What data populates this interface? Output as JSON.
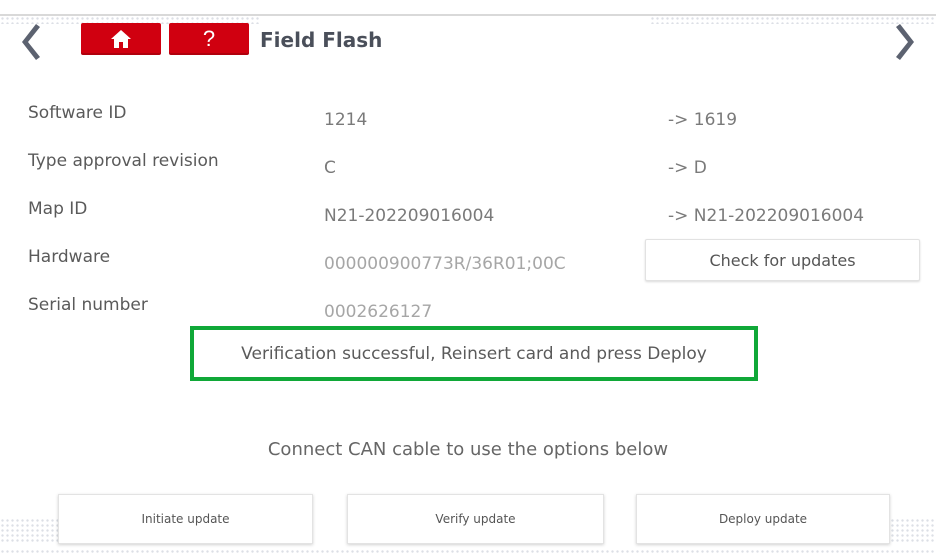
{
  "header": {
    "title": "Field Flash",
    "help_label": "?",
    "icons": {
      "back": "chevron-left-icon",
      "forward": "chevron-right-icon",
      "home": "home-icon"
    },
    "accent_color": "#d00010"
  },
  "info": {
    "rows": [
      {
        "label": "Software ID",
        "value": "1214",
        "new": "-> 1619"
      },
      {
        "label": "Type approval revision",
        "value": "C",
        "new": "-> D"
      },
      {
        "label": "Map ID",
        "value": "N21-202209016004",
        "new": "-> N21-202209016004"
      },
      {
        "label": "Hardware",
        "value": "000000900773R/36R01;00C"
      },
      {
        "label": "Serial number",
        "value": "0002626127"
      }
    ]
  },
  "check_updates_label": "Check for updates",
  "status": {
    "message": "Verification successful, Reinsert card and press Deploy",
    "border_color": "#10a838"
  },
  "can_message": "Connect CAN cable to use the options below",
  "actions": {
    "initiate": "Initiate update",
    "verify": "Verify update",
    "deploy": "Deploy update"
  }
}
